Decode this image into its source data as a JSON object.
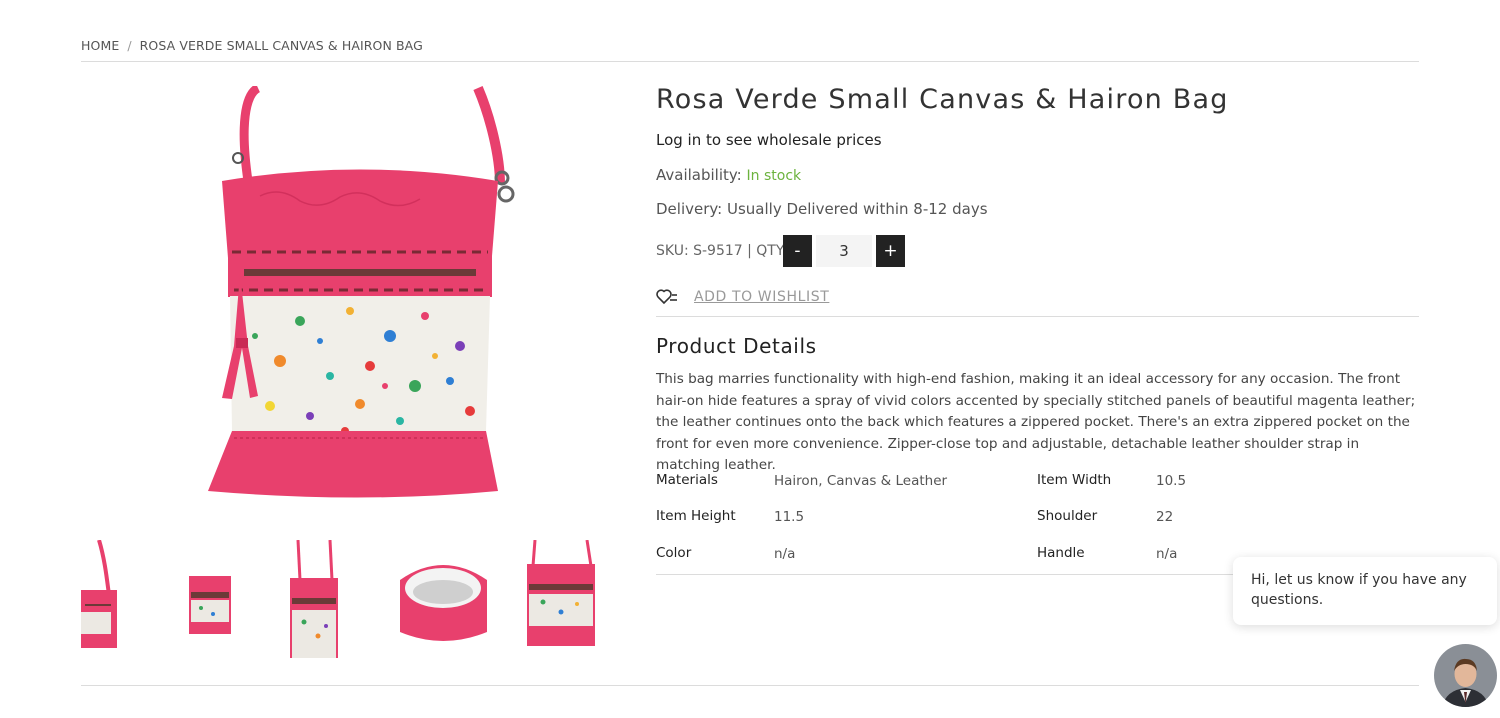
{
  "breadcrumb": {
    "home": "HOME",
    "separator": "/",
    "current": "ROSA VERDE SMALL CANVAS & HAIRON BAG"
  },
  "product": {
    "title": "Rosa Verde Small Canvas & Hairon Bag",
    "login_prompt": "Log in to see wholesale prices",
    "availability_label": "Availability:",
    "availability_value": "In stock",
    "delivery": "Delivery: Usually Delivered within 8-12 days",
    "sku_qty": "SKU: S-9517 | QTY",
    "qty": {
      "minus": "-",
      "value": "3",
      "plus": "+"
    },
    "wishlist_label": "ADD TO WISHLIST",
    "details_heading": "Product Details",
    "description": "This bag marries functionality with high-end fashion, making it an ideal accessory for any occasion. The front hair-on hide features a spray of vivid colors accented by specially stitched panels of beautiful magenta leather; the leather continues onto the back which features a zippered pocket. There's an extra zippered pocket on the front for even more convenience. Zipper-close top and adjustable, detachable leather shoulder strap in matching leather.",
    "specs_left": [
      {
        "key": "Materials",
        "value": "Hairon, Canvas & Leather"
      },
      {
        "key": "Item Height",
        "value": "11.5"
      },
      {
        "key": "Color",
        "value": "n/a"
      }
    ],
    "specs_right": [
      {
        "key": "Item Width",
        "value": "10.5"
      },
      {
        "key": "Shoulder",
        "value": "22"
      },
      {
        "key": "Handle",
        "value": "n/a"
      }
    ]
  },
  "chat": {
    "message": "Hi, let us know if you have any questions."
  },
  "colors": {
    "in_stock": "#6cb33e",
    "bag_pink": "#e8406d",
    "button_dark": "#222222"
  }
}
